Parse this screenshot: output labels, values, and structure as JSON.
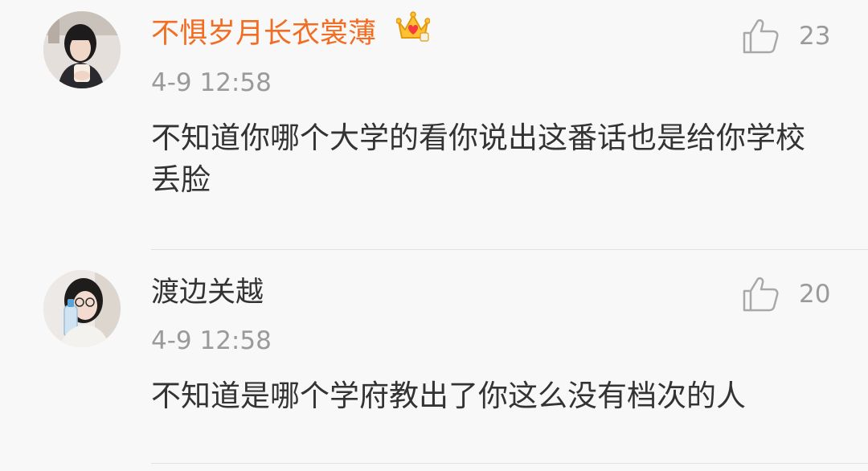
{
  "comments": [
    {
      "username": "不惧岁月长衣裳薄",
      "timestamp": "4-9 12:58",
      "text": "不知道你哪个大学的看你说出这番话也是给你学校丢脸",
      "likes": "23",
      "vip_badge_icon": "crown-icon",
      "name_color": "#f26d21"
    },
    {
      "username": "渡边关越",
      "timestamp": "4-9 12:58",
      "text": "不知道是哪个学府教出了你这么没有档次的人",
      "likes": "20",
      "name_color": "#333333"
    }
  ],
  "colors": {
    "background": "#f8f8f8",
    "meta_gray": "#9a9a9a",
    "divider": "#e2e2e2"
  }
}
